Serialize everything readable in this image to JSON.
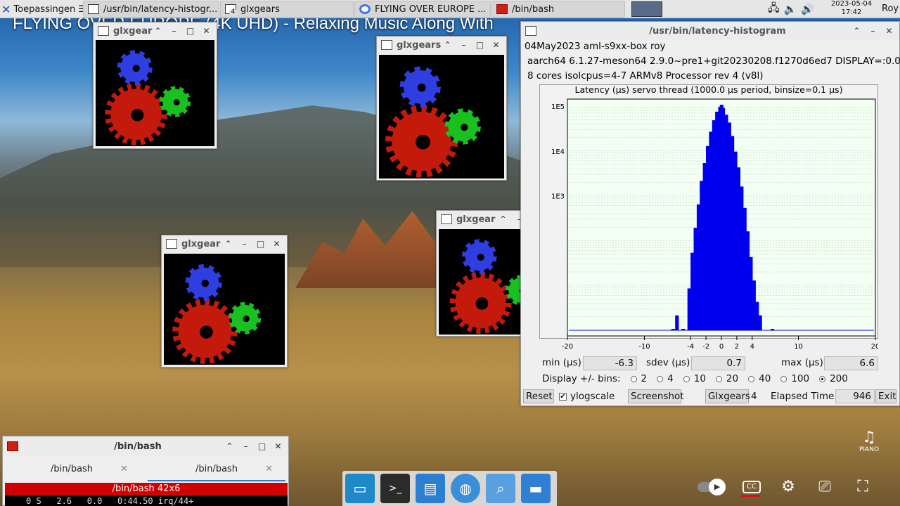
{
  "taskbar": {
    "start_label": "Toepassingen",
    "tasks": [
      {
        "label": "/usr/bin/latency-histogr..."
      },
      {
        "label": "glxgears",
        "badge": "4"
      },
      {
        "label": "FLYING OVER EUROPE ..."
      },
      {
        "label": "/bin/bash"
      }
    ],
    "clock_date": "2023-05-04",
    "clock_time": "17:42",
    "user": "Roy"
  },
  "video": {
    "title": "FLYING OVER EUROPE (4K UHD) - Relaxing Music Along With",
    "logo_text": "PIANO"
  },
  "gears": [
    {
      "title": "glxgear"
    },
    {
      "title": "glxgears"
    },
    {
      "title": "glxgear"
    },
    {
      "title": "glxgear"
    }
  ],
  "histogram": {
    "window_title": "/usr/bin/latency-histogram",
    "info_line1": "04May2023 aml-s9xx-box roy",
    "info_line2": "aarch64  6.1.27-meson64  2.9.0~pre1+git20230208.f1270d6ed7  DISPLAY=:0.0",
    "info_line3": "8 cores  isolcpus=4-7     ARMv8 Processor rev 4 (v8l)",
    "min_label": "min (µs)",
    "min_value": "-6.3",
    "sdev_label": "sdev (µs)",
    "sdev_value": "0.7",
    "max_label": "max (µs)",
    "max_value": "6.6",
    "bins_label": "Display +/- bins:",
    "bins_options": [
      "2",
      "4",
      "10",
      "20",
      "40",
      "100",
      "200"
    ],
    "bins_selected": "200",
    "reset_label": "Reset",
    "ylog_label": "ylogscale",
    "screenshot_label": "Screenshot",
    "glxgears_label": "Glxgears",
    "glxgears_count": "4",
    "elapsed_label": "Elapsed Time:",
    "elapsed_value": "946",
    "exit_label": "Exit"
  },
  "chart_data": {
    "type": "bar",
    "title": "Latency (µs) servo thread (1000.0 µs period, binsize=0.1 µs)",
    "xlim": [
      -20,
      20
    ],
    "x_ticks": [
      "-20",
      "-10",
      "-4",
      "-2",
      "0",
      "2",
      "4",
      "10",
      "20"
    ],
    "x_tick_values": [
      -20,
      -10,
      -4,
      -2,
      0,
      2,
      4,
      10,
      20
    ],
    "y_scale": "log",
    "ylim": [
      1,
      100000
    ],
    "y_ticks": [
      "1E5",
      "1E4",
      "1E3"
    ],
    "y_tick_values": [
      100000,
      10000,
      1000
    ],
    "color": "#0000ee",
    "bins_x": [
      -4.2,
      -3.8,
      -3.4,
      -3.0,
      -2.6,
      -2.2,
      -1.8,
      -1.4,
      -1.0,
      -0.6,
      -0.2,
      0.0,
      0.2,
      0.6,
      1.0,
      1.4,
      1.8,
      2.2,
      2.6,
      3.0,
      3.4,
      3.8,
      4.2,
      4.6,
      5.0,
      6.6,
      -6.3,
      -5.8,
      -5.0
    ],
    "bins_y": [
      8,
      50,
      180,
      600,
      2000,
      5000,
      12000,
      25000,
      45000,
      70000,
      90000,
      100000,
      85000,
      60000,
      40000,
      20000,
      9000,
      4000,
      1500,
      500,
      150,
      40,
      12,
      4,
      2,
      1,
      1,
      2,
      1
    ]
  }
}
